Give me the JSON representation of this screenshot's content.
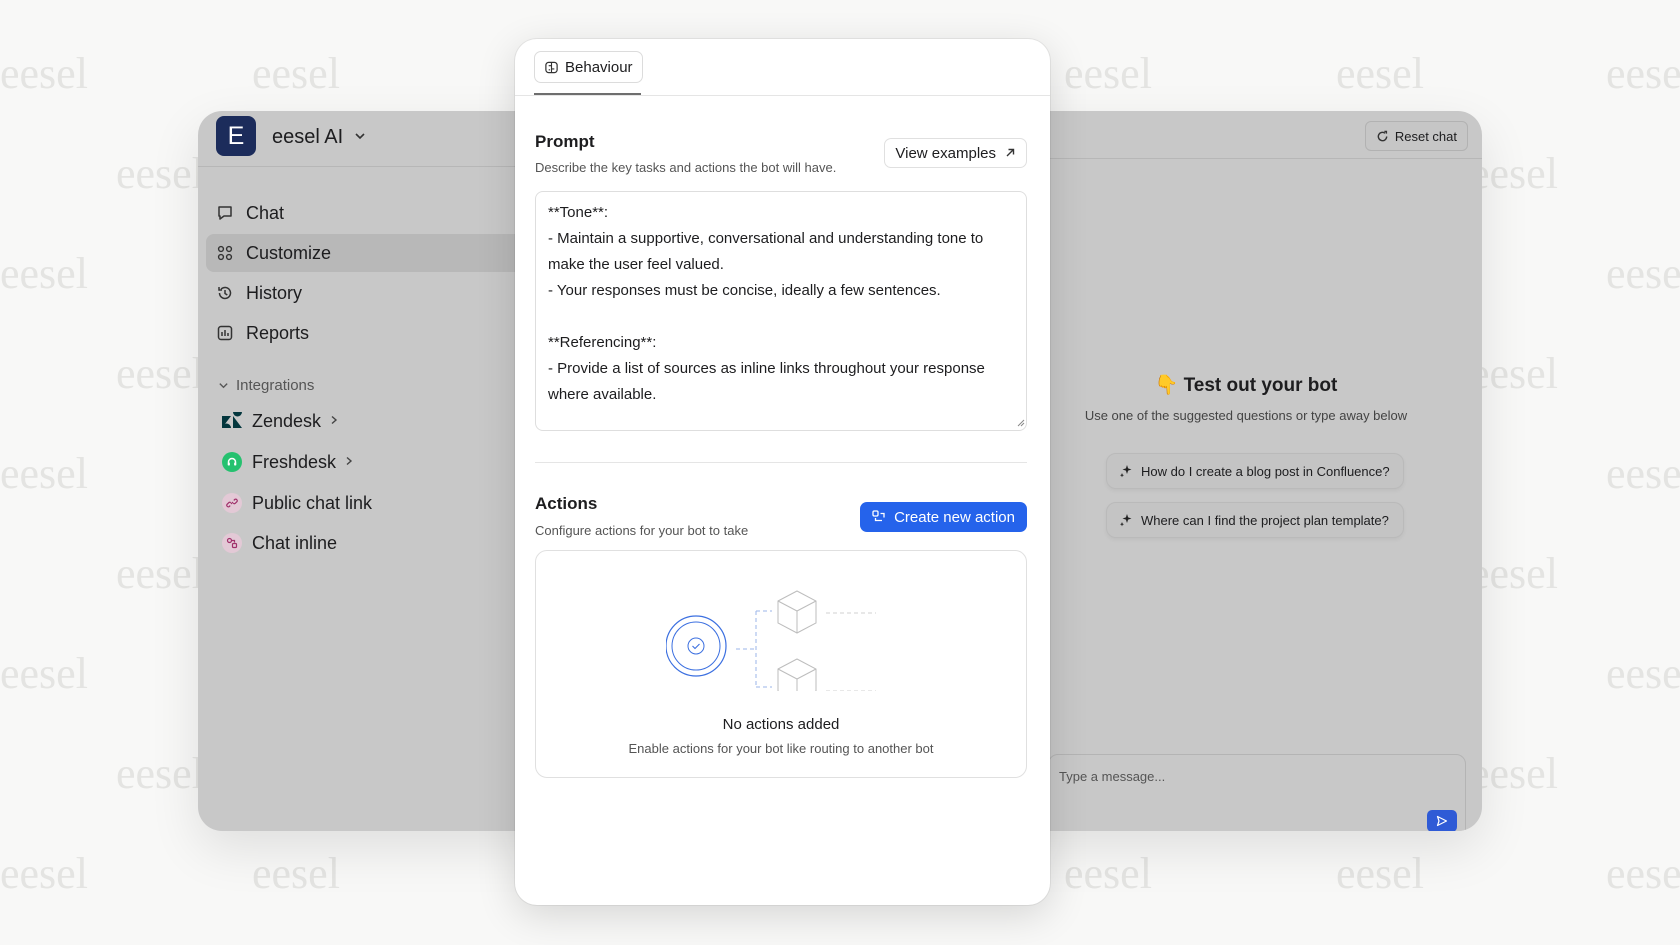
{
  "watermark_text": "eesel",
  "sidebar": {
    "logo_letter": "E",
    "brand": "eesel AI",
    "nav": [
      {
        "label": "Chat",
        "icon": "chat-bubble-icon"
      },
      {
        "label": "Customize",
        "icon": "customize-grid-icon",
        "active": true
      },
      {
        "label": "History",
        "icon": "history-icon"
      },
      {
        "label": "Reports",
        "icon": "reports-icon"
      }
    ],
    "integrations_label": "Integrations",
    "integrations": [
      {
        "label": "Zendesk",
        "icon": "zendesk-icon"
      },
      {
        "label": "Freshdesk",
        "icon": "freshdesk-icon"
      },
      {
        "label": "Public chat link",
        "icon": "link-icon"
      },
      {
        "label": "Chat inline",
        "icon": "chat-inline-icon"
      }
    ]
  },
  "chat_panel": {
    "reset_label": "Reset chat",
    "test_title": "👇 Test out your bot",
    "test_subtitle": "Use one of the suggested questions or type away below",
    "suggestions": [
      "How do I create a blog post in Confluence?",
      "Where can I find the project plan template?"
    ],
    "message_placeholder": "Type a message..."
  },
  "card": {
    "tab_label": "Behaviour",
    "prompt": {
      "title": "Prompt",
      "description": "Describe the key tasks and actions the bot will have.",
      "view_examples_label": "View examples",
      "text": "**Tone**:\n- Maintain a supportive, conversational and understanding tone to make the user feel valued.\n- Your responses must be concise, ideally a few sentences.\n\n**Referencing**:\n- Provide a list of sources as inline links throughout your response where available."
    },
    "actions": {
      "title": "Actions",
      "description": "Configure actions for your bot to take",
      "create_label": "Create new action",
      "empty_title": "No actions added",
      "empty_description": "Enable actions for your bot like routing to another bot"
    }
  },
  "colors": {
    "accent": "#2563eb",
    "logo_bg": "#1c2c5b",
    "zendesk": "#03363d",
    "freshdesk": "#25c16f"
  }
}
